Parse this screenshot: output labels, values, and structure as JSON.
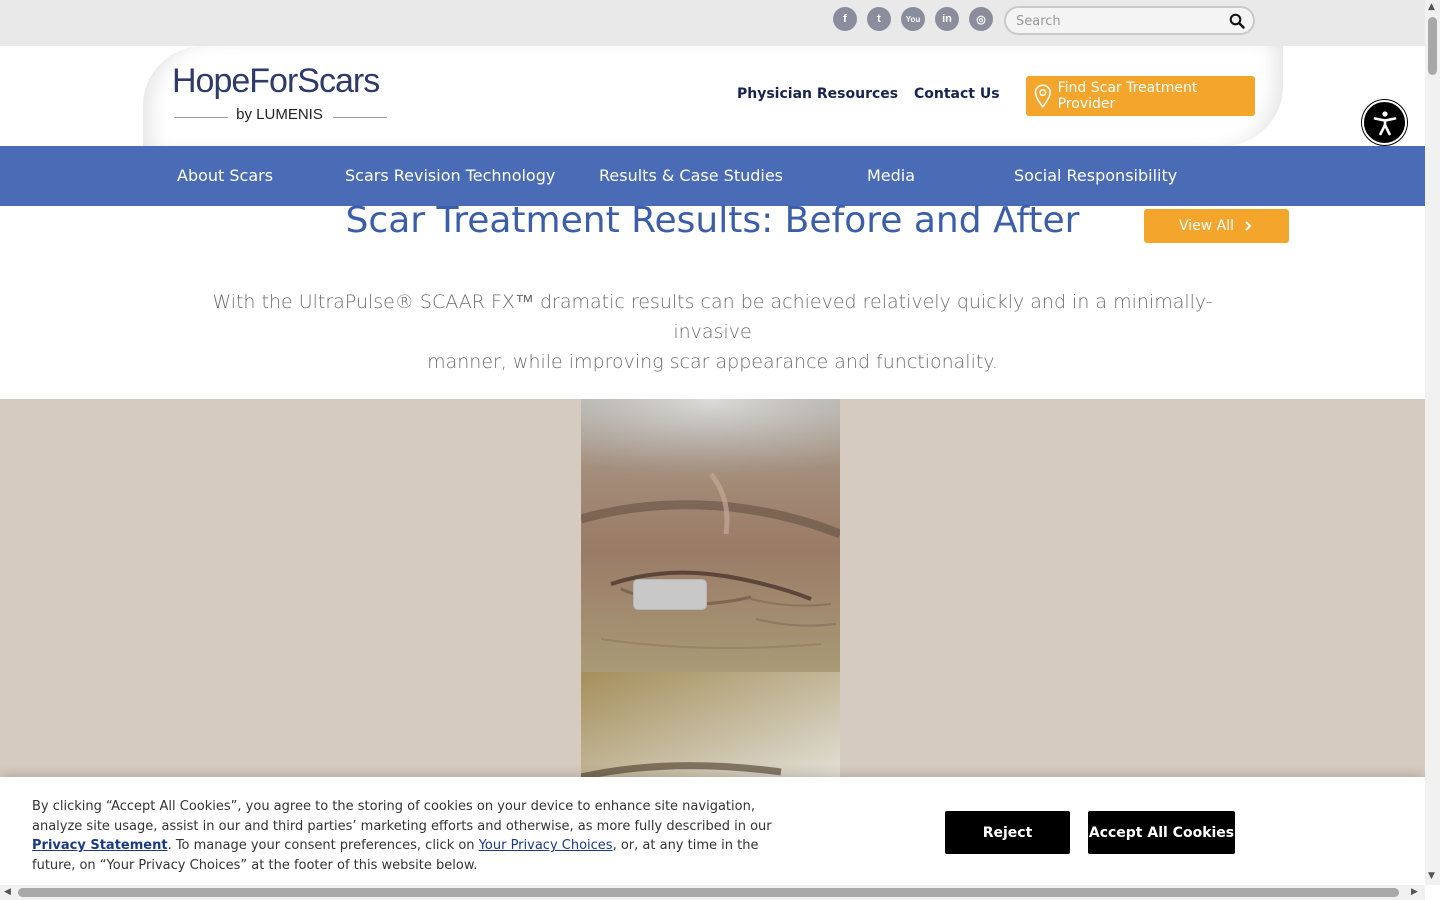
{
  "topbar": {
    "social": [
      {
        "name": "facebook",
        "glyph": "f"
      },
      {
        "name": "twitter",
        "glyph": "t"
      },
      {
        "name": "youtube",
        "glyph": "You"
      },
      {
        "name": "linkedin",
        "glyph": "in"
      },
      {
        "name": "instagram",
        "glyph": "◎"
      }
    ],
    "search": {
      "placeholder": "Search"
    }
  },
  "header": {
    "logo_title": "HopeForScars",
    "logo_sub": "by LUMENIS",
    "links": [
      "Physician Resources",
      "Contact Us"
    ],
    "cta": "Find Scar Treatment Provider"
  },
  "nav": {
    "items": [
      "About Scars",
      "Scars Revision Technology",
      "Results & Case Studies",
      "Media",
      "Social Responsibility"
    ]
  },
  "main": {
    "title": "Scar Treatment Results: Before and After",
    "view_all": "View All",
    "intro_line1": "With the UltraPulse® SCAAR FX™ dramatic results can be achieved relatively quickly and in a minimally-invasive",
    "intro_line2": "manner, while improving scar appearance and functionality."
  },
  "cookie": {
    "text_a": "By clicking “Accept All Cookies”, you agree to the storing of cookies on your device to enhance site navigation, analyze site usage, assist in our and third parties’ marketing efforts and otherwise, as more fully described in our ",
    "privacy_link": "Privacy Statement",
    "text_b": ". To manage your consent preferences, click on ",
    "choices_link": "Your Privacy Choices",
    "text_c": ", or, at any time in the future, on “Your Privacy Choices” at the footer of this website below.",
    "reject": "Reject",
    "accept": "Accept All Cookies"
  },
  "colors": {
    "nav_blue": "#4a6bb5",
    "accent_orange": "#f4a52c",
    "title_blue": "#3c5da9",
    "gallery_bg": "#d5cbc1"
  }
}
